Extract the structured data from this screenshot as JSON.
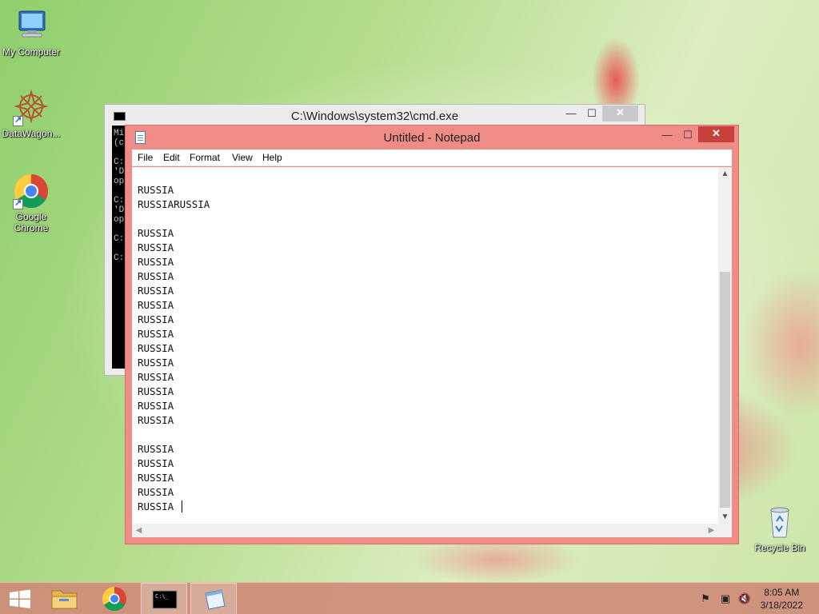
{
  "desktop": {
    "icons": [
      {
        "label": "My Computer",
        "icon": "my-computer-icon"
      },
      {
        "label": "DataWagon...",
        "icon": "datawagon-icon"
      },
      {
        "label": "Google Chrome",
        "icon": "chrome-icon"
      },
      {
        "label": "Recycle Bin",
        "icon": "recycle-bin-icon"
      }
    ]
  },
  "cmd": {
    "title": "C:\\Windows\\system32\\cmd.exe",
    "minimize": "—",
    "maximize": "☐",
    "close": "✕",
    "console_text": "Mi\n(c\n\nC:\n'D\nop\n\nC:\n'D\nop\n\nC:\n\nC:"
  },
  "notepad": {
    "title": "Untitled - Notepad",
    "minimize": "—",
    "maximize": "☐",
    "close": "✕",
    "menu": [
      "File",
      "Edit",
      "Format",
      "View",
      "Help"
    ],
    "content": "RUSSIA\nRUSSIARUSSIA\n\nRUSSIA\nRUSSIA\nRUSSIA\nRUSSIA\nRUSSIA\nRUSSIA\nRUSSIA\nRUSSIA\nRUSSIA\nRUSSIA\nRUSSIA\nRUSSIA\nRUSSIA\nRUSSIA\n\nRUSSIA\nRUSSIA\nRUSSIA\nRUSSIA\nRUSSIA ",
    "scroll_up": "▲",
    "scroll_down": "▼",
    "scroll_left": "◀",
    "scroll_right": "▶"
  },
  "taskbar": {
    "apps": [
      "start-icon",
      "file-explorer-icon",
      "chrome-icon",
      "cmd-icon",
      "notepad-icon"
    ],
    "clock_time": "8:05 AM",
    "clock_date": "3/18/2022",
    "accent": "#ce8c78"
  }
}
